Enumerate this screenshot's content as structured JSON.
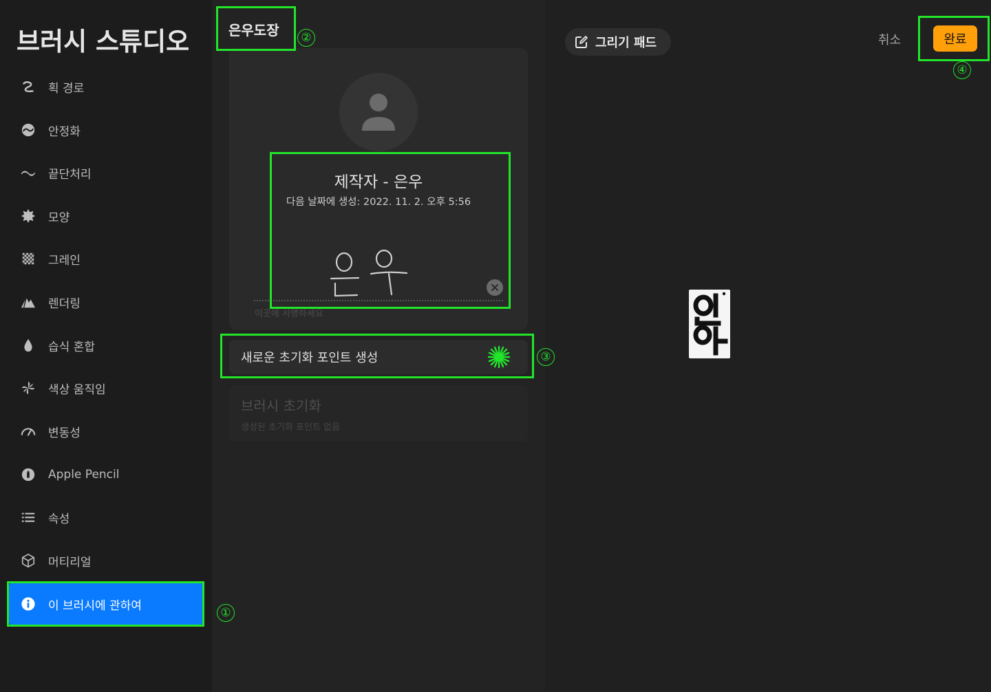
{
  "sidebar": {
    "title": "브러시 스튜디오",
    "items": [
      {
        "label": "획 경로",
        "icon": "stroke-path-icon"
      },
      {
        "label": "안정화",
        "icon": "stabilization-icon"
      },
      {
        "label": "끝단처리",
        "icon": "taper-icon"
      },
      {
        "label": "모양",
        "icon": "shape-icon"
      },
      {
        "label": "그레인",
        "icon": "grain-icon"
      },
      {
        "label": "렌더링",
        "icon": "rendering-icon"
      },
      {
        "label": "습식 혼합",
        "icon": "wet-mix-icon"
      },
      {
        "label": "색상 움직임",
        "icon": "color-dynamics-icon"
      },
      {
        "label": "변동성",
        "icon": "dynamics-icon"
      },
      {
        "label": "Apple Pencil",
        "icon": "apple-pencil-icon"
      },
      {
        "label": "속성",
        "icon": "properties-icon"
      },
      {
        "label": "머티리얼",
        "icon": "materials-icon"
      },
      {
        "label": "이 브러시에 관하여",
        "icon": "info-icon",
        "active": true
      }
    ]
  },
  "middle": {
    "title": "은우도장",
    "author": {
      "title": "제작자 - 은우",
      "created": "다음 날짜에 생성: 2022. 11. 2. 오후 5:56",
      "signature_hint": "이곳에 서명하세요"
    },
    "create_reset_point": "새로운 초기화 포인트 생성",
    "reset": {
      "title": "브러시 초기화",
      "subtitle": "생성된 초기화 포인트 없음"
    }
  },
  "right": {
    "drawing_pad": "그리기 패드",
    "cancel": "취소",
    "done": "완료"
  },
  "annotations": [
    "①",
    "②",
    "③",
    "④"
  ],
  "colors": {
    "accent_blue": "#0a7aff",
    "done_orange": "#ff9f0a",
    "highlight_green": "#22e52a"
  }
}
